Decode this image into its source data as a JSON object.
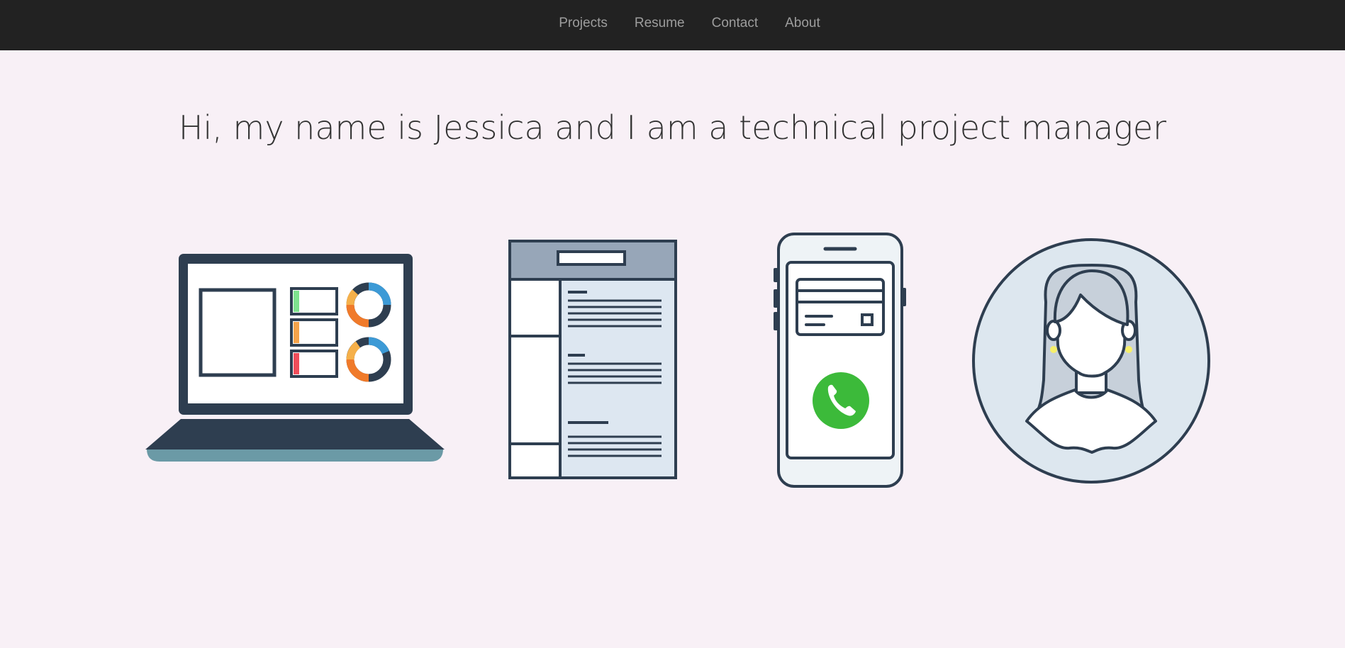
{
  "nav": {
    "items": [
      {
        "label": "Projects",
        "icon": "laptop-dashboard-icon"
      },
      {
        "label": "Resume",
        "icon": "resume-document-icon"
      },
      {
        "label": "Contact",
        "icon": "phone-call-icon"
      },
      {
        "label": "About",
        "icon": "woman-avatar-icon"
      }
    ]
  },
  "hero": {
    "headline": "Hi, my name is Jessica and I am a technical project manager"
  },
  "colors": {
    "navbar_bg": "#222222",
    "nav_text": "#9d9d9d",
    "page_bg": "#f8f0f6",
    "ink": "#2e3e50",
    "call_green": "#3cba3a",
    "donut_blue": "#3c9ad6",
    "donut_orange": "#f07a2a"
  }
}
